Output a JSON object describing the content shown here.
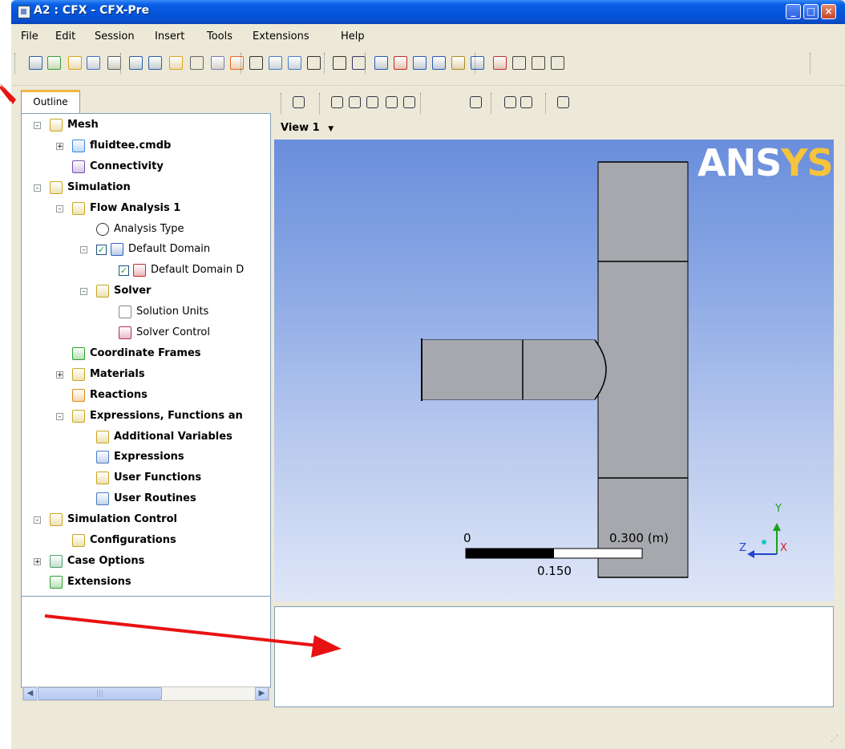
{
  "window": {
    "title": "A2 : CFX - CFX-Pre"
  },
  "menu": [
    "File",
    "Edit",
    "Session",
    "Insert",
    "Tools",
    "Extensions",
    "Help"
  ],
  "toolbar_icons": [
    "save-icon",
    "reload-icon",
    "import-mesh-icon",
    "mesh-icon",
    "camera-icon",
    "undo-icon",
    "redo-icon",
    "import-icon",
    "domain-icon",
    "material-icon",
    "reaction-icon",
    "variable-icon",
    "expression-icon",
    "user-routine-icon",
    "user-function-icon",
    "timer-icon",
    "settings-icon",
    "box-icon",
    "interface-icon",
    "region-icon",
    "subdomain-icon",
    "boundary-icon",
    "initialization-icon",
    "solver-control-icon",
    "output-control-icon",
    "definition-icon",
    "write-solver-icon"
  ],
  "outline": {
    "tab_label": "Outline",
    "tree": [
      {
        "label": "Mesh",
        "bold": true
      },
      {
        "label": "fluidtee.cmdb",
        "bold": true
      },
      {
        "label": "Connectivity",
        "bold": true
      },
      {
        "label": "Simulation",
        "bold": true
      },
      {
        "label": "Flow Analysis 1",
        "bold": true
      },
      {
        "label": "Analysis Type",
        "bold": false
      },
      {
        "label": "Default Domain",
        "bold": false
      },
      {
        "label": "Default Domain D",
        "bold": false
      },
      {
        "label": "Solver",
        "bold": true
      },
      {
        "label": "Solution Units",
        "bold": false
      },
      {
        "label": "Solver Control",
        "bold": false
      },
      {
        "label": "Coordinate Frames",
        "bold": true
      },
      {
        "label": "Materials",
        "bold": true
      },
      {
        "label": "Reactions",
        "bold": true
      },
      {
        "label": "Expressions, Functions an",
        "bold": true
      },
      {
        "label": "Additional Variables",
        "bold": true
      },
      {
        "label": "Expressions",
        "bold": true
      },
      {
        "label": "User Functions",
        "bold": true
      },
      {
        "label": "User Routines",
        "bold": true
      },
      {
        "label": "Simulation Control",
        "bold": true
      },
      {
        "label": "Configurations",
        "bold": true
      },
      {
        "label": "Case Options",
        "bold": true
      },
      {
        "label": "Extensions",
        "bold": true
      }
    ]
  },
  "viewer": {
    "view_label": "View 1",
    "logo_main": "ANS",
    "logo_accent": "YS",
    "scale": {
      "left": "0",
      "right": "0.300  (m)",
      "mid": "0.150"
    },
    "axes": {
      "y": "Y",
      "z": "Z",
      "x": "X"
    }
  },
  "colors": {
    "titlebar": "#0454d8",
    "arrow": "#e81212",
    "logo_yellow": "#f5c43c"
  }
}
